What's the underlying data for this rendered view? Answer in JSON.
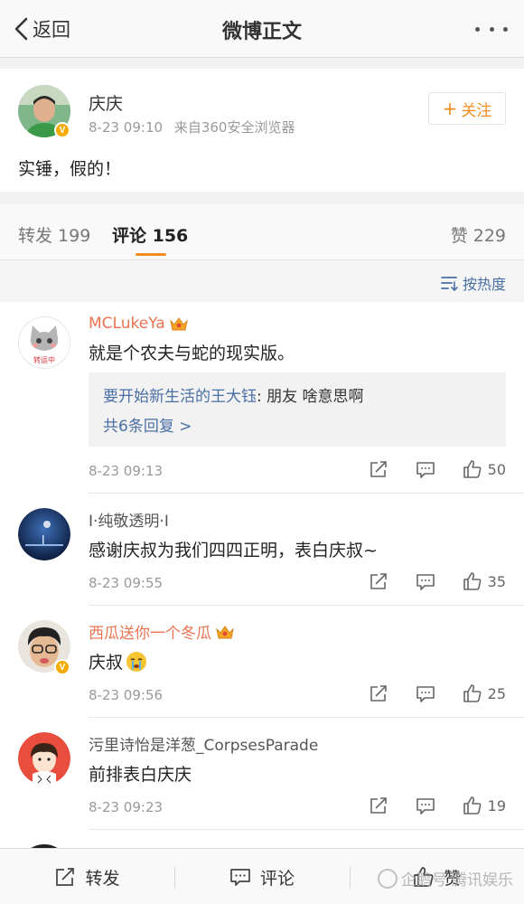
{
  "nav": {
    "back_label": "返回",
    "title": "微博正文",
    "more_icon": "more-dots-icon"
  },
  "post": {
    "author": "庆庆",
    "time": "8-23 09:10",
    "source": "来自360安全浏览器",
    "follow_label": "关注",
    "text": "实锤，假的！",
    "verified_badge": "V"
  },
  "tabs": {
    "repost": "转发 199",
    "comment": "评论 156",
    "like": "赞 229"
  },
  "sort": {
    "label": "按热度"
  },
  "comments": [
    {
      "name": "MCLukeYa",
      "text": "就是个农夫与蛇的现实版。",
      "reply_user": "要开始新生活的王大钰",
      "reply_text": "朋友 啥意思啊",
      "reply_more": "共6条回复 >",
      "time": "8-23 09:13",
      "likes": "50",
      "avatar_text": "转运中"
    },
    {
      "name": "I·纯敬透明·I",
      "text": "感谢庆叔为我们四四正明，表白庆叔~",
      "time": "8-23 09:55",
      "likes": "35"
    },
    {
      "name": "西瓜送你一个冬瓜",
      "text": "庆叔",
      "time": "8-23 09:56",
      "likes": "25"
    },
    {
      "name": "污里诗怡是洋葱_CorpsesParade",
      "text": "前排表白庆庆",
      "time": "8-23 09:23",
      "likes": "19"
    }
  ],
  "bottom": {
    "repost": "转发",
    "comment": "评论",
    "like": "赞",
    "watermark": "企鹅号 腾讯娱乐"
  },
  "colors": {
    "accent_orange": "#f28c21",
    "name_orange": "#eb7350",
    "link_blue": "#4a6fa5"
  }
}
